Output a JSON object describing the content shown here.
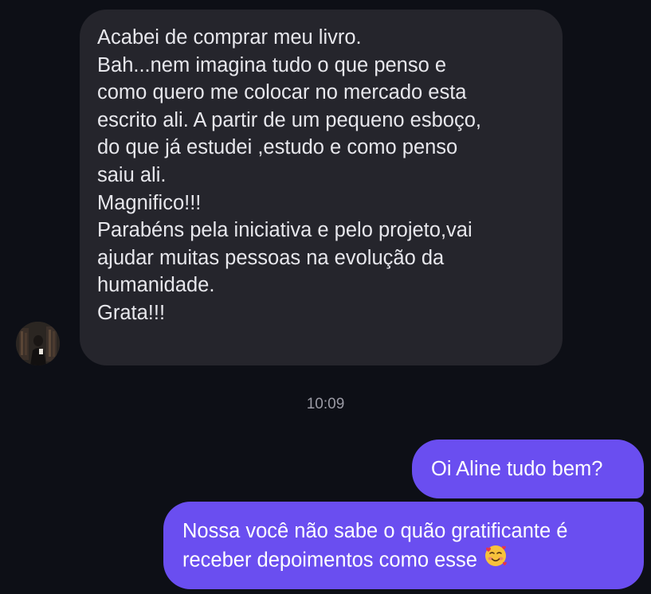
{
  "conversation": {
    "incoming": {
      "sender_avatar": "profile-photo",
      "lines": [
        "Acabei de comprar meu livro.",
        "Bah...nem imagina tudo o que penso e",
        "como quero me colocar no mercado esta",
        "escrito ali. A partir de um pequeno esboço,",
        "do que já estudei ,estudo e  como penso",
        "saiu ali.",
        "Magnifico!!!",
        "Parabéns pela iniciativa e pelo projeto,vai",
        "ajudar muitas pessoas na evolução da",
        "humanidade.",
        "Grata!!!"
      ]
    },
    "timestamp": "10:09",
    "outgoing": [
      {
        "lines": [
          "Oi Aline tudo bem?"
        ]
      },
      {
        "lines": [
          "Nossa você não sabe o quão gratificante é",
          "receber depoimentos como esse"
        ],
        "emoji": "smiling-face-with-hearts-icon"
      }
    ]
  },
  "colors": {
    "background": "#0d0f16",
    "incoming_bubble": "#25252c",
    "outgoing_bubble": "#6a4ef0",
    "timestamp_text": "#9a9aa4"
  }
}
